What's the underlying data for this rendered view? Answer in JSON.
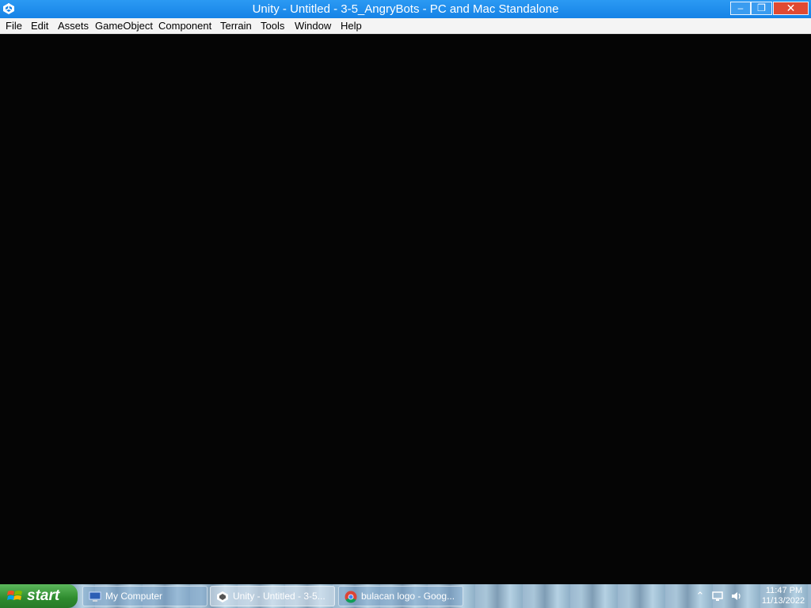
{
  "window": {
    "title": "Unity - Untitled - 3-5_AngryBots - PC and Mac Standalone",
    "icon": "unity-icon",
    "controls": {
      "minimize": "–",
      "maximize": "❐",
      "close": "✕"
    }
  },
  "menubar": {
    "items": [
      {
        "label": "File"
      },
      {
        "label": "Edit"
      },
      {
        "label": "Assets"
      },
      {
        "label": "GameObject"
      },
      {
        "label": "Component"
      },
      {
        "label": "Terrain"
      },
      {
        "label": "Tools"
      },
      {
        "label": "Window"
      },
      {
        "label": "Help"
      }
    ]
  },
  "taskbar": {
    "start_label": "start",
    "tasks": [
      {
        "label": "My Computer",
        "icon": "my-computer-icon"
      },
      {
        "label": "Unity - Untitled - 3-5...",
        "icon": "unity-icon"
      },
      {
        "label": "bulacan logo - Goog...",
        "icon": "chrome-icon"
      }
    ],
    "tray": {
      "icons": [
        "chevron-up-icon",
        "network-icon",
        "volume-icon"
      ],
      "time": "11:47 PM",
      "date": "11/13/2022"
    }
  },
  "colors": {
    "titlebar": "#1683e6",
    "close_button": "#e04a33",
    "viewport": "#050505",
    "start_button": "#2e8b2e"
  }
}
